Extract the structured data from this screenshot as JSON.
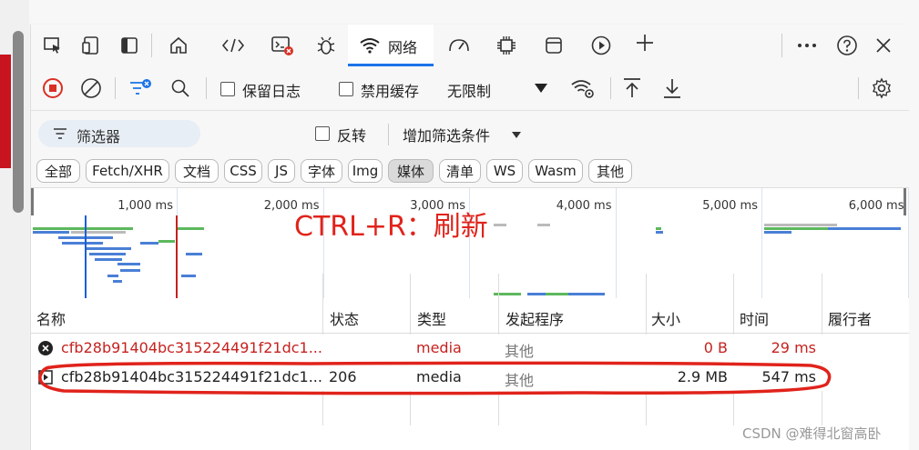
{
  "tabs": {
    "network_label": "网络"
  },
  "toolbar": {
    "preserve_log": "保留日志",
    "disable_cache": "禁用缓存",
    "throttle": "无限制"
  },
  "filter": {
    "placeholder": "筛选器",
    "invert": "反转",
    "more_filters": "增加筛选条件"
  },
  "type_filters": [
    "全部",
    "Fetch/XHR",
    "文档",
    "CSS",
    "JS",
    "字体",
    "Img",
    "媒体",
    "清单",
    "WS",
    "Wasm",
    "其他"
  ],
  "active_type_filter": "媒体",
  "timeline": {
    "ticks": [
      "1,000 ms",
      "2,000 ms",
      "3,000 ms",
      "4,000 ms",
      "5,000 ms",
      "6,000 ms"
    ]
  },
  "annotation": "CTRL+R：刷新",
  "table": {
    "headers": [
      "名称",
      "状态",
      "类型",
      "发起程序",
      "大小",
      "时间",
      "履行者"
    ],
    "rows": [
      {
        "icon": "error-icon",
        "name": "cfb28b91404bc315224491f21dc1...",
        "status": "",
        "type": "media",
        "initiator": "其他",
        "size": "0 B",
        "time": "29 ms",
        "fulfilled": "",
        "failed": true
      },
      {
        "icon": "media-file-icon",
        "name": "cfb28b91404bc315224491f21dc1...",
        "status": "206",
        "type": "media",
        "initiator": "其他",
        "size": "2.9 MB",
        "time": "547 ms",
        "fulfilled": "",
        "failed": false
      }
    ]
  },
  "watermark": "CSDN @难得北窗高卧",
  "colors": {
    "accent": "#1a73e8",
    "error": "#c5221f",
    "annotation": "#e0231b"
  }
}
